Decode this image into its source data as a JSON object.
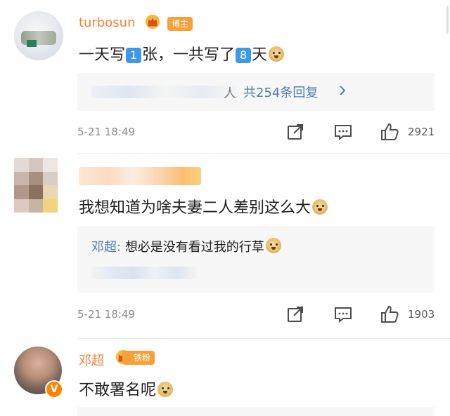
{
  "colors": {
    "username": "#f08436",
    "link": "#507daf",
    "tag": "#f7a037",
    "reply_bg": "#f7f7f7",
    "number_emoji": "#3e98ea"
  },
  "comments": [
    {
      "username": "turbosun",
      "tag": "博主",
      "text_part1": "一天写",
      "num1": "1",
      "text_part2": "张，一共写了",
      "num2": "8",
      "text_part3": "天",
      "emoji": "doge",
      "reply_blurred_tail": "人",
      "reply_summary": "共254条回复",
      "reply_chevron": "chevron-right-icon",
      "date": "5-21 18:49",
      "likes": "2921"
    },
    {
      "text": "我想知道为啥夫妻二人差别这么大",
      "emoji": "doge",
      "reply_name": "邓超",
      "reply_colon": ":",
      "reply_text": "想必是没有看过我的行草",
      "date": "5-21 18:49",
      "likes": "1903"
    },
    {
      "username": "邓超",
      "tag": "铁粉",
      "verified_badge": "V",
      "text": "不敢署名呢",
      "emoji": "doge"
    }
  ],
  "icons": {
    "share": "share-icon",
    "comment": "comment-icon",
    "like": "thumbs-up-icon",
    "crown": "crown-icon"
  }
}
